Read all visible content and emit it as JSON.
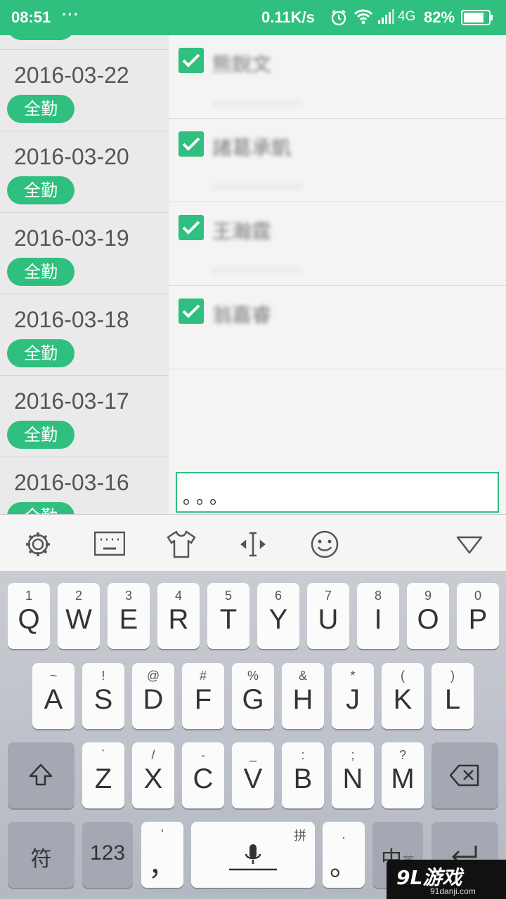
{
  "status_bar": {
    "time": "08:51",
    "more": "···",
    "speed": "0.11K/s",
    "network": "4G",
    "battery_pct": "82%",
    "battery_level": 0.82
  },
  "dates": [
    {
      "date": "",
      "badge": "全勤"
    },
    {
      "date": "2016-03-22",
      "badge": "全勤"
    },
    {
      "date": "2016-03-20",
      "badge": "全勤"
    },
    {
      "date": "2016-03-19",
      "badge": "全勤"
    },
    {
      "date": "2016-03-18",
      "badge": "全勤"
    },
    {
      "date": "2016-03-17",
      "badge": "全勤"
    },
    {
      "date": "2016-03-16",
      "badge": "全勤"
    }
  ],
  "people": [
    {
      "name": "熊銳文",
      "checked": true
    },
    {
      "name": "諸葛承凱",
      "checked": true
    },
    {
      "name": "王瀚霆",
      "checked": true
    },
    {
      "name": "翁嘉睿",
      "checked": true
    }
  ],
  "input": {
    "value": "。。。"
  },
  "keyboard": {
    "row1": [
      {
        "sym": "1",
        "key": "Q"
      },
      {
        "sym": "2",
        "key": "W"
      },
      {
        "sym": "3",
        "key": "E"
      },
      {
        "sym": "4",
        "key": "R"
      },
      {
        "sym": "5",
        "key": "T"
      },
      {
        "sym": "6",
        "key": "Y"
      },
      {
        "sym": "7",
        "key": "U"
      },
      {
        "sym": "8",
        "key": "I"
      },
      {
        "sym": "9",
        "key": "O"
      },
      {
        "sym": "0",
        "key": "P"
      }
    ],
    "row2": [
      {
        "sym": "~",
        "key": "A"
      },
      {
        "sym": "!",
        "key": "S"
      },
      {
        "sym": "@",
        "key": "D"
      },
      {
        "sym": "#",
        "key": "F"
      },
      {
        "sym": "%",
        "key": "G"
      },
      {
        "sym": "&",
        "key": "H"
      },
      {
        "sym": "*",
        "key": "J"
      },
      {
        "sym": "(",
        "key": "K"
      },
      {
        "sym": ")",
        "key": "L"
      }
    ],
    "row3": [
      {
        "sym": "`",
        "key": "Z"
      },
      {
        "sym": "/",
        "key": "X"
      },
      {
        "sym": "-",
        "key": "C"
      },
      {
        "sym": "_",
        "key": "V"
      },
      {
        "sym": ":",
        "key": "B"
      },
      {
        "sym": ";",
        "key": "N"
      },
      {
        "sym": "?",
        "key": "M"
      }
    ],
    "symbols_label": "符",
    "numbers_label": "123",
    "comma_top": "'",
    "comma": "，",
    "space_pinyin": "拼",
    "period_top": ".",
    "period": "。",
    "lang_main": "中",
    "lang_sub": "英"
  },
  "watermark": {
    "brand": "9L游戏",
    "url": "91danji.com"
  },
  "colors": {
    "accent": "#2fbf7f",
    "list_bg": "#eaeaea",
    "keyboard_bg": "#b4b8c1"
  }
}
